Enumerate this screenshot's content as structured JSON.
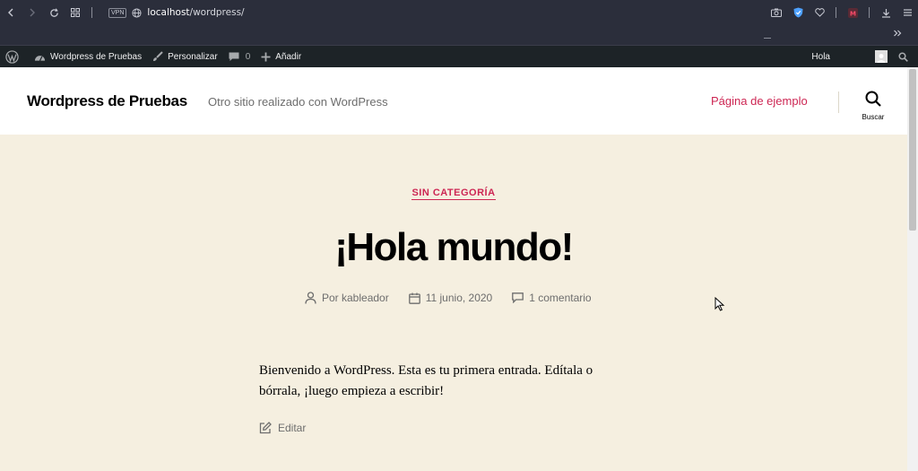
{
  "browser": {
    "url_host": "localhost",
    "url_path": "/wordpress/",
    "vpn_label": "VPN"
  },
  "admin_bar": {
    "site_name": "Wordpress de Pruebas",
    "customize": "Personalizar",
    "comments_count": "0",
    "add_new": "Añadir",
    "greeting": "Hola"
  },
  "header": {
    "site_title": "Wordpress de Pruebas",
    "tagline": "Otro sitio realizado con WordPress",
    "menu_item": "Página de ejemplo",
    "search_label": "Buscar"
  },
  "post": {
    "category": "SIN CATEGORÍA",
    "title": "¡Hola mundo!",
    "author": "Por kableador",
    "date": "11 junio, 2020",
    "comments": "1 comentario",
    "content": "Bienvenido a WordPress. Esta es tu primera entrada. Edítala o bórrala, ¡luego empieza a escribir!",
    "edit": "Editar"
  },
  "colors": {
    "accent": "#cd2653",
    "background": "#f5efe0",
    "admin_bar": "#1d2327"
  }
}
